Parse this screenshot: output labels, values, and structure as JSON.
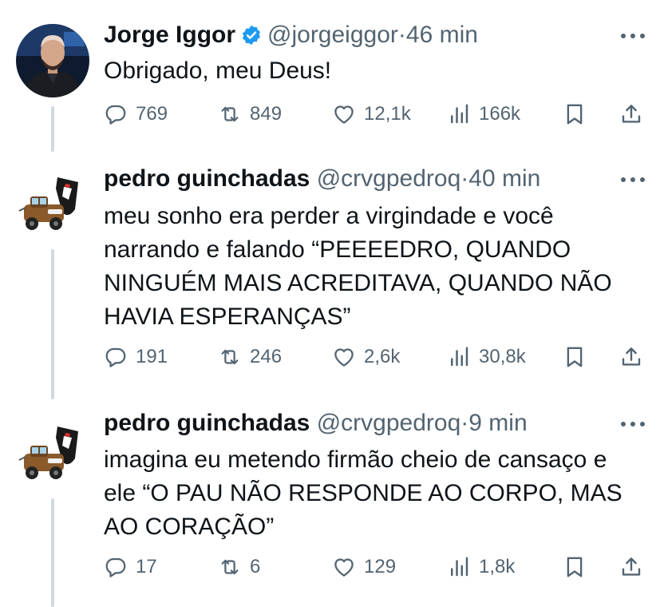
{
  "tweets": [
    {
      "name": "Jorge Iggor",
      "verified": true,
      "handle": "@jorgeiggor",
      "dot": "·",
      "time": "46 min",
      "text": "Obrigado, meu Deus!",
      "replies": "769",
      "retweets": "849",
      "likes": "12,1k",
      "views": "166k"
    },
    {
      "name": "pedro guinchadas",
      "verified": false,
      "handle": "@crvgpedroq",
      "dot": "·",
      "time": "40 min",
      "text": "meu sonho era perder a virgindade e você narrando e falando “PEEEEDRO, QUANDO NINGUÉM MAIS ACREDITAVA, QUANDO NÃO HAVIA ESPERANÇAS”",
      "replies": "191",
      "retweets": "246",
      "likes": "2,6k",
      "views": "30,8k"
    },
    {
      "name": "pedro guinchadas",
      "verified": false,
      "handle": "@crvgpedroq",
      "dot": "·",
      "time": "9 min",
      "text": "imagina eu metendo firmão cheio de cansaço e ele “O PAU NÃO RESPONDE AO CORPO, MAS AO CORAÇÃO”",
      "replies": "17",
      "retweets": "6",
      "likes": "129",
      "views": "1,8k"
    }
  ],
  "icons": {
    "reply": "reply-icon",
    "retweet": "retweet-icon",
    "like": "heart-icon",
    "views": "views-icon",
    "bookmark": "bookmark-icon",
    "share": "share-icon",
    "more": "more-icon",
    "verified": "verified-badge-icon"
  },
  "colors": {
    "text": "#0f1419",
    "secondary": "#536471",
    "verified": "#1d9bf0",
    "thread_line": "#cfd9de"
  }
}
